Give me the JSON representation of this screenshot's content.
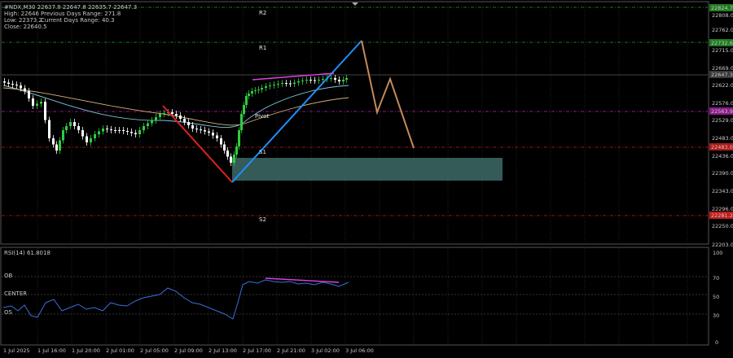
{
  "header": {
    "symbol_line": "#NDX,M30  22637.8 22647.8 22635.7 22647.3",
    "high": "High: 22646",
    "prev_range": "Previous Days Range: 271.8",
    "low": "Low: 22373.2",
    "curr_range": "Current Days Range: 40.3",
    "close": "Close: 22640.5"
  },
  "levels": {
    "r2": "R2",
    "r1": "R1",
    "pivot": "Pivot",
    "s1": "S1",
    "s2": "S2"
  },
  "price_axis": {
    "ticks": [
      "22808.0",
      "22762.0",
      "22715.0",
      "22669.0",
      "22622.0",
      "22576.0",
      "22529.0",
      "22483.0",
      "22436.0",
      "22390.0",
      "22343.0",
      "22296.0",
      "22250.0",
      "22203.0"
    ],
    "badges": [
      {
        "text": "22824.7",
        "color": "#1f7a1f"
      },
      {
        "text": "22732.6",
        "color": "#1f7a1f"
      },
      {
        "text": "22647.3",
        "color": "#3a3a3a"
      },
      {
        "text": "22563.9",
        "color": "#8a1a8a"
      },
      {
        "text": "22483.0",
        "color": "#b01919"
      },
      {
        "text": "22281.2",
        "color": "#c31a1a"
      }
    ]
  },
  "rsi": {
    "label": "RSI(14) 61.8018",
    "ob": "OB",
    "center": "CENTER",
    "os": "OS",
    "ticks": [
      "100",
      "70",
      "50",
      "30",
      "0"
    ]
  },
  "time_axis": {
    "labels": [
      "1 Jul 2025",
      "1 Jul 16:00",
      "1 Jul 20:00",
      "2 Jul 01:00",
      "2 Jul 05:00",
      "2 Jul 09:00",
      "2 Jul 13:00",
      "2 Jul 17:00",
      "2 Jul 21:00",
      "3 Jul 02:00",
      "3 Jul 06:00"
    ]
  },
  "colors": {
    "grid": "#4a4a4a",
    "bull": "#2ecc40",
    "bear": "#ffffff",
    "red_line": "#e02020",
    "blue_line": "#1e90ff",
    "brown_line": "#c48a5a",
    "zone": "#3d6b66",
    "magenta": "#e040e0",
    "r_level": "#2d9a2d",
    "pivot_level": "#c020c0",
    "s_level": "#c02020",
    "ma_fast": "#7ec8e3",
    "ma_slow": "#d8b27a",
    "rsi_line": "#3a6fd8"
  }
}
